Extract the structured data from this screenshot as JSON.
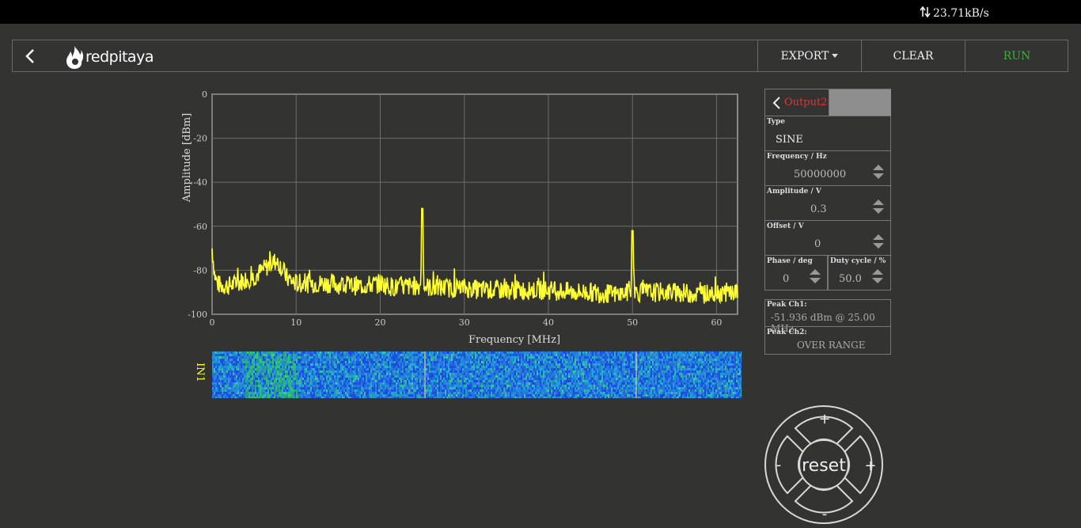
{
  "status": {
    "speed": "23.71kB/s"
  },
  "header": {
    "brand": "redpitaya",
    "export_label": "EXPORT",
    "clear_label": "CLEAR",
    "run_label": "RUN",
    "run_color": "#3cae3c"
  },
  "chart_data": {
    "type": "line",
    "xlabel": "Frequency   [MHz]",
    "ylabel": "Amplitude  [dBm]",
    "xlim": [
      0,
      62.5
    ],
    "ylim": [
      -100,
      0
    ],
    "xticks": [
      0,
      10,
      20,
      30,
      40,
      50,
      60
    ],
    "yticks": [
      0,
      -20,
      -40,
      -60,
      -80,
      -100
    ],
    "grid": true,
    "series": [
      {
        "color": "#ffff33",
        "x": [
          0,
          0.3,
          0.6,
          1,
          2,
          3,
          4,
          5,
          6,
          7,
          7.5,
          8,
          9,
          10,
          12,
          14,
          16,
          18,
          20,
          22,
          24,
          24.8,
          25,
          25.2,
          26,
          28,
          30,
          32,
          35,
          38,
          40,
          43,
          45,
          48,
          49.8,
          50,
          50.2,
          52,
          55,
          58,
          60,
          62.5
        ],
        "y": [
          -70,
          -82,
          -86,
          -87,
          -87,
          -86,
          -84,
          -83,
          -80,
          -77,
          -76,
          -77,
          -84,
          -86,
          -86,
          -86,
          -87,
          -87,
          -86,
          -88,
          -87,
          -87,
          -52,
          -87,
          -88,
          -88,
          -88,
          -89,
          -89,
          -89,
          -89,
          -90,
          -90,
          -91,
          -90,
          -62,
          -90,
          -90,
          -90,
          -91,
          -90,
          -90
        ]
      }
    ],
    "peaks": [
      {
        "x": 25.0,
        "y": -51.936
      },
      {
        "x": 50.0,
        "y": -62
      }
    ]
  },
  "waterfall": {
    "label": "IN1"
  },
  "generator": {
    "output_name": "Output2",
    "type_label": "Type",
    "type_value": "SINE",
    "freq_label": "Frequency   / Hz",
    "freq_value": "50000000",
    "amp_label": "Amplitude  / V",
    "amp_value": "0.3",
    "offset_label": "Offset  / V",
    "offset_value": "0",
    "phase_label": "Phase   / deg",
    "phase_value": "0",
    "duty_label": "Duty cycle  / %",
    "duty_value": "50.0"
  },
  "peaks": {
    "ch1_label": "Peak  Ch1:",
    "ch1_value": "-51.936  dBm  @  25.00  MHz",
    "ch2_label": "Peak  Ch2:",
    "ch2_value": "OVER RANGE"
  },
  "dpad": {
    "center": "reset",
    "up": "+",
    "down": "-",
    "left": "-",
    "right": "+"
  },
  "icons": {
    "upload_download": "updown-arrows-icon",
    "back": "chevron-left-icon",
    "logo": "flame-logo-icon"
  }
}
